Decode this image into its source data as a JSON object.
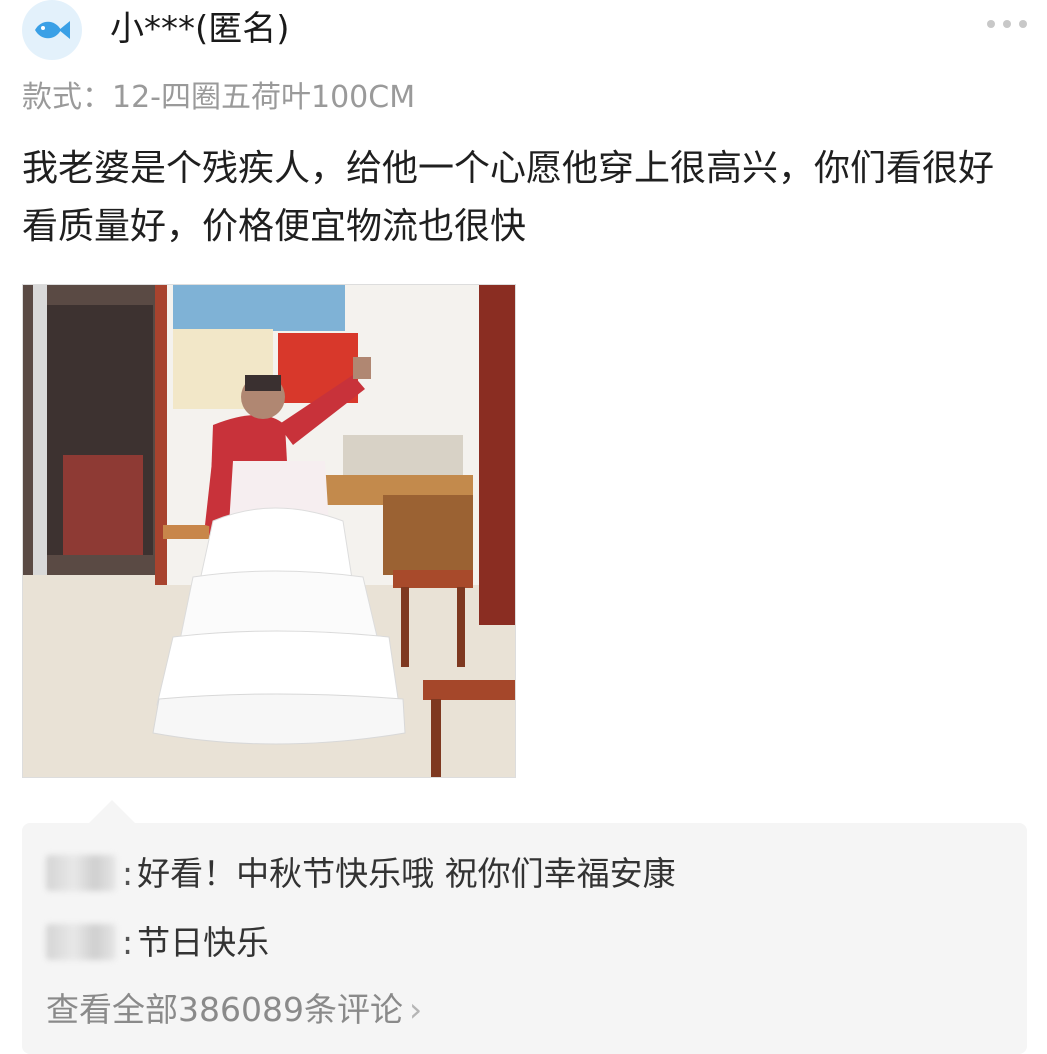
{
  "header": {
    "username": "小***(匿名)",
    "avatar_icon": "fish-icon",
    "avatar_color": "#3aa0e6",
    "more_icon": "more-dots-icon"
  },
  "review": {
    "style_label": "款式：",
    "style_value": "12-四圈五荷叶100CM",
    "text": "我老婆是个残疾人，给他一个心愿他穿上很高兴，你们看很好看质量好，价格便宜物流也很快"
  },
  "comments": [
    {
      "text": "好看！中秋节快乐哦 祝你们幸福安康"
    },
    {
      "text": "节日快乐"
    }
  ],
  "view_all": {
    "label": "查看全部386089条评论",
    "chevron": "›"
  },
  "colors": {
    "comment_bg": "#f5f5f5",
    "muted_text": "#9a9a9a"
  }
}
